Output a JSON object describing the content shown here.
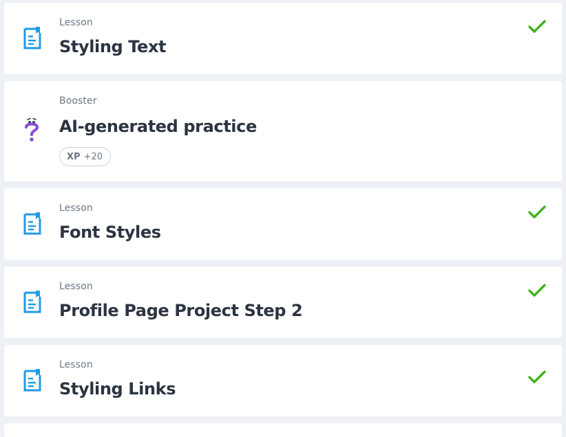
{
  "items": [
    {
      "type_label": "Lesson",
      "title": "Styling Text",
      "completed": true,
      "icon": "lesson-document-icon"
    },
    {
      "type_label": "Booster",
      "title": "AI-generated practice",
      "completed": false,
      "icon": "question-mark-icon",
      "xp_badge": {
        "label": "XP",
        "value": "+20"
      }
    },
    {
      "type_label": "Lesson",
      "title": "Font Styles",
      "completed": true,
      "icon": "lesson-document-icon"
    },
    {
      "type_label": "Lesson",
      "title": "Profile Page Project Step 2",
      "completed": true,
      "icon": "lesson-document-icon"
    },
    {
      "type_label": "Lesson",
      "title": "Styling Links",
      "completed": true,
      "icon": "lesson-document-icon"
    }
  ],
  "colors": {
    "accent_blue": "#1f9be6",
    "check_green": "#3eb31a",
    "booster_purple": "#8a52d6",
    "page_bg": "#edf1f5"
  }
}
